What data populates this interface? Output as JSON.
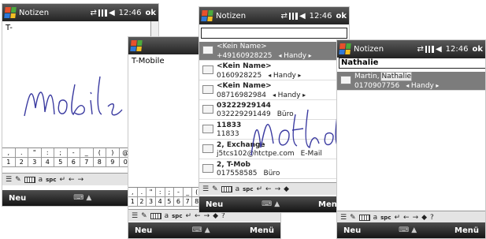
{
  "screen1": {
    "title": "Notizen",
    "time": "12:46",
    "ok": "ok",
    "text": "T-",
    "keys": [
      [
        ",",
        ".",
        "\"",
        ":",
        ";",
        "-",
        "_",
        "(",
        ")",
        "@",
        "?",
        "!"
      ],
      [
        "1",
        "2",
        "3",
        "4",
        "5",
        "6",
        "7",
        "8",
        "9",
        "0",
        "&",
        "+"
      ]
    ],
    "im": [
      "spc",
      "↵",
      "←",
      "→"
    ],
    "menu_left": "Neu",
    "menu_right": "Me"
  },
  "screen2": {
    "text": "T-Mobile",
    "keys": [
      [
        ",",
        ".",
        "\"",
        ":",
        ";",
        "-",
        "_",
        "("
      ],
      [
        "1",
        "2",
        "3",
        "4",
        "5",
        "6",
        "7",
        "8"
      ]
    ],
    "im": [
      "spc",
      "↵",
      "←",
      "→",
      "◆",
      "?"
    ],
    "menu_left": "Neu",
    "menu_right": "Menü"
  },
  "screen3": {
    "title": "Notizen",
    "time": "12:46",
    "ok": "ok",
    "search": "",
    "rows": [
      {
        "name": "<Kein Name>",
        "num": "+49160928225",
        "type": "Handy"
      },
      {
        "name": "<Kein Name>",
        "num": "0160928225",
        "type": "Handy"
      },
      {
        "name": "<Kein Name>",
        "num": "08716982984",
        "type": "Handy"
      },
      {
        "name": "03222929144",
        "num": "032229291449",
        "type": "Büro"
      },
      {
        "name": "11833",
        "num": "11833",
        "type": ""
      },
      {
        "name": "2, Exchange",
        "num": "j5tcs102@htctpe.com",
        "type": "E-Mail"
      },
      {
        "name": "2, T-Mob",
        "num": "017558585",
        "type": "Büro"
      }
    ],
    "im": [
      "spc",
      "↵",
      "←",
      "→",
      "◆"
    ],
    "menu_left": "Neu",
    "menu_right": "Menü"
  },
  "screen4": {
    "title": "Notizen",
    "time": "12:46",
    "ok": "ok",
    "search": "Nathalie",
    "row": {
      "name1": "Martin,",
      "name2": "Nathalie",
      "num": "0170907756",
      "type": "Handy"
    },
    "im": [
      "spc",
      "↵",
      "←",
      "→",
      "◆",
      "?"
    ],
    "menu_left": "Neu",
    "menu_right": "Menü"
  },
  "colors": {
    "titlebar": "#2a2a2a",
    "selection": "#7c7c7c",
    "ink": "#3a3aa0"
  }
}
